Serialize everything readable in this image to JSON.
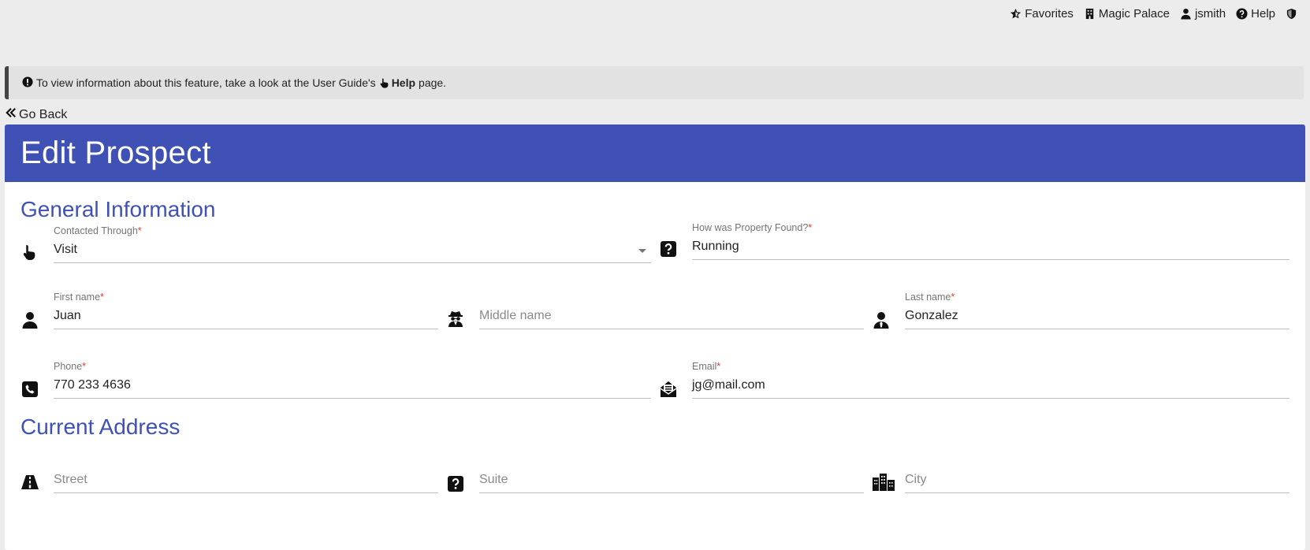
{
  "topnav": {
    "favorites": "Favorites",
    "property": "Magic Palace",
    "user": "jsmith",
    "help": "Help"
  },
  "notice": {
    "text_before": "To view information about this feature, take a look at the User Guide's",
    "help_link": "Help",
    "text_after": "page."
  },
  "go_back": "Go Back",
  "page_title": "Edit Prospect",
  "sections": {
    "general": "General Information",
    "address": "Current Address"
  },
  "fields": {
    "contacted_through": {
      "label": "Contacted Through",
      "required": "*",
      "value": "Visit"
    },
    "property_found": {
      "label": "How was Property Found?",
      "required": "*",
      "value": "Running"
    },
    "first_name": {
      "label": "First name",
      "required": "*",
      "value": "Juan"
    },
    "middle_name": {
      "placeholder": "Middle name"
    },
    "last_name": {
      "label": "Last name",
      "required": "*",
      "value": "Gonzalez"
    },
    "phone": {
      "label": "Phone",
      "required": "*",
      "value": "770 233 4636"
    },
    "email": {
      "label": "Email",
      "required": "*",
      "value": "jg@mail.com"
    },
    "street": {
      "placeholder": "Street"
    },
    "suite": {
      "placeholder": "Suite"
    },
    "city": {
      "placeholder": "City"
    }
  },
  "colors": {
    "accent": "#3f51b5",
    "required": "#e53935",
    "background": "#ececec"
  }
}
